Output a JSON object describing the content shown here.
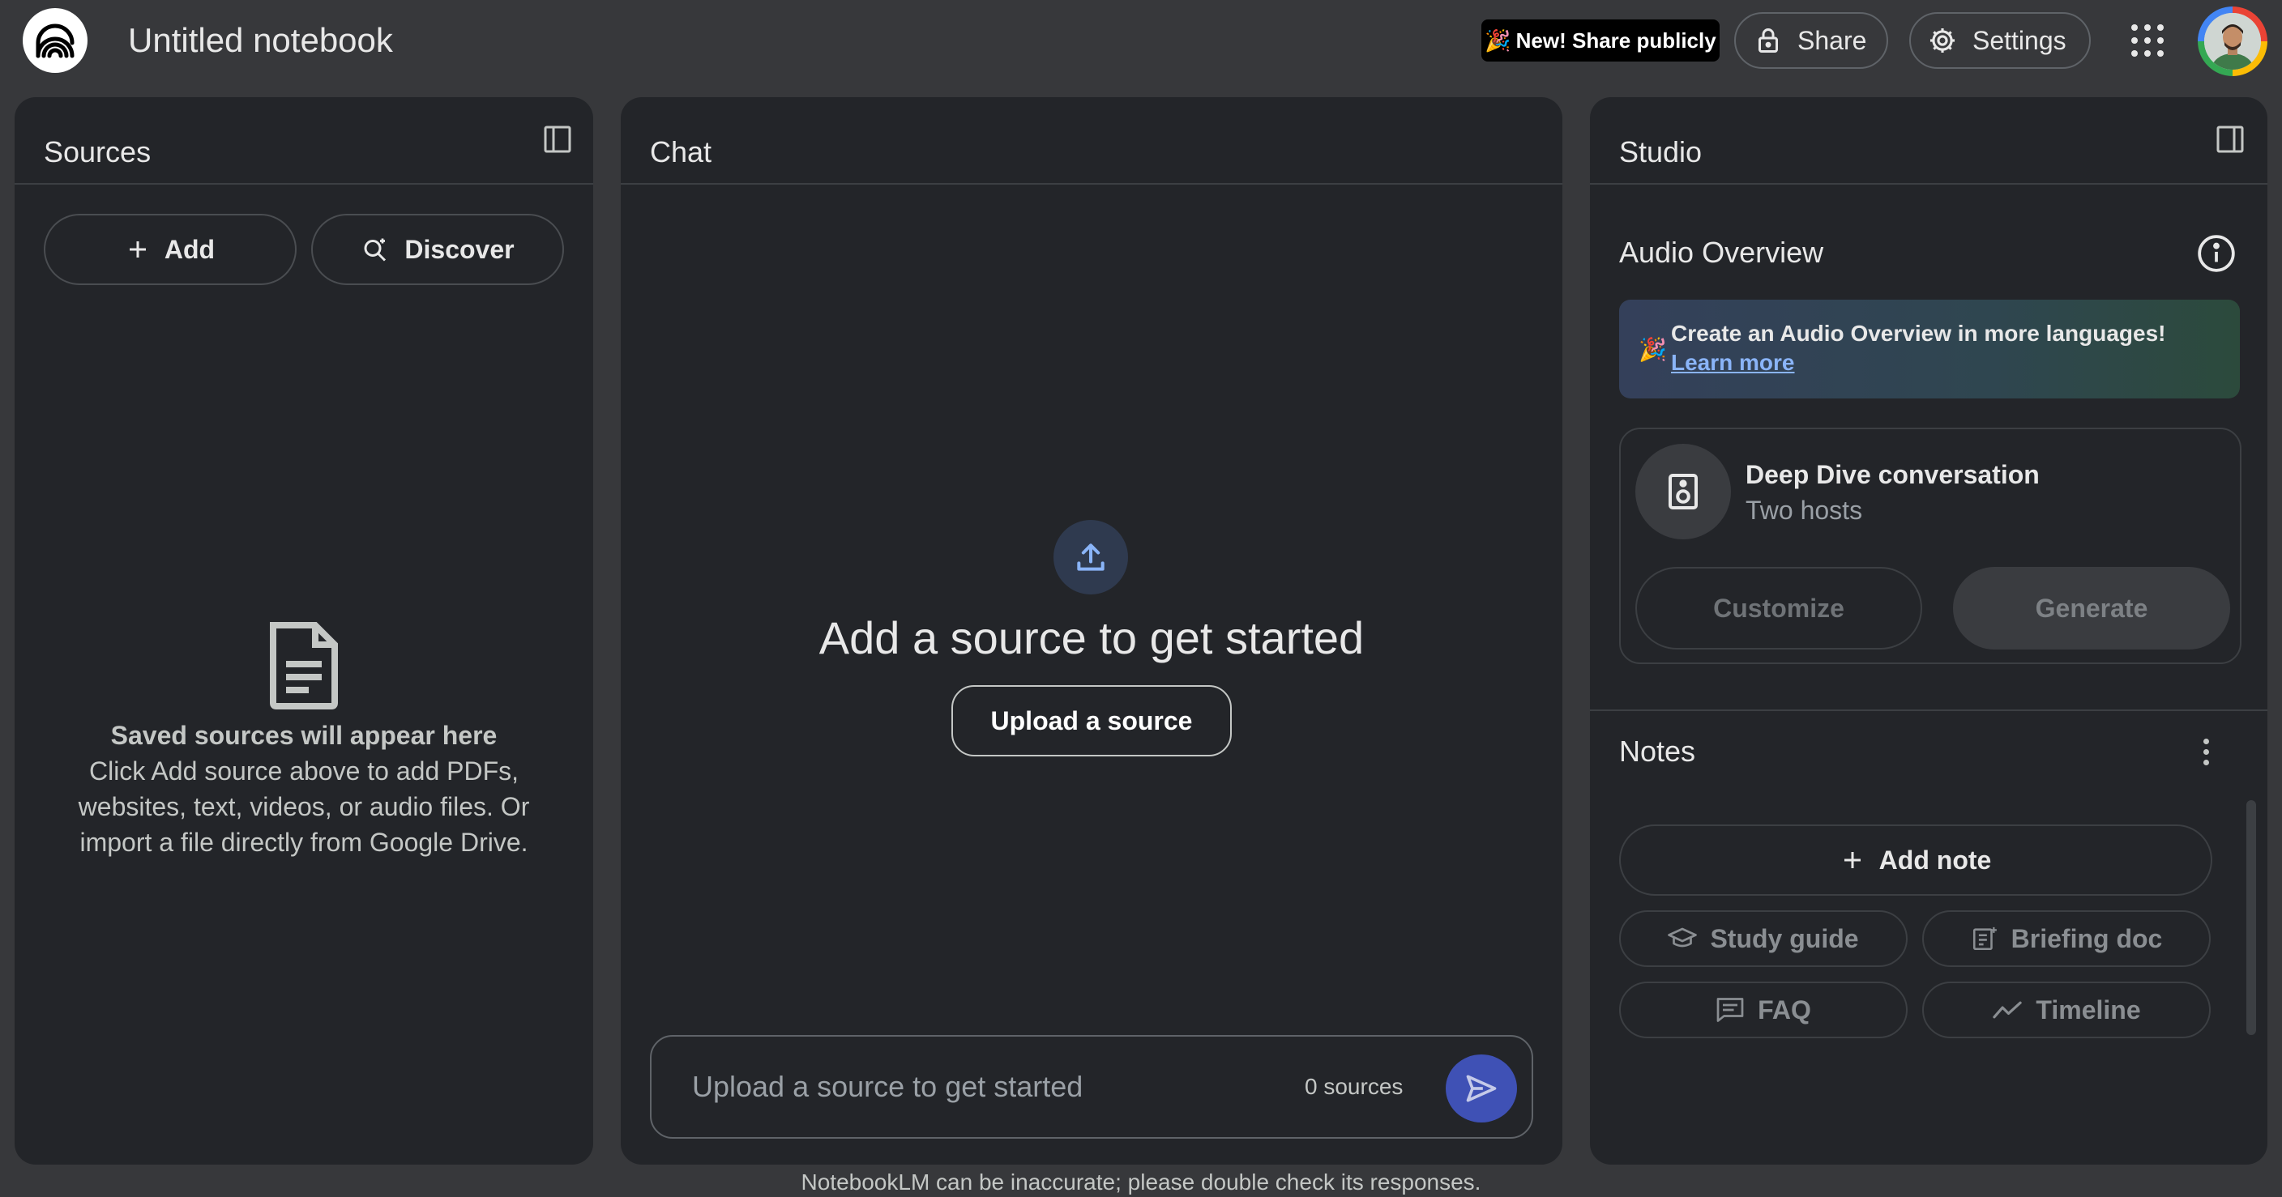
{
  "header": {
    "notebook_title": "Untitled notebook",
    "promo_label": "New! Share publicly",
    "share_label": "Share",
    "settings_label": "Settings"
  },
  "sources": {
    "title": "Sources",
    "add_label": "Add",
    "discover_label": "Discover",
    "empty_heading": "Saved sources will appear here",
    "empty_body": "Click Add source above to add PDFs, websites, text, videos, or audio files. Or import a file directly from Google Drive."
  },
  "chat": {
    "title": "Chat",
    "headline": "Add a source to get started",
    "upload_label": "Upload a source",
    "input_placeholder": "Upload a source to get started",
    "source_count": "0 sources"
  },
  "studio": {
    "title": "Studio",
    "audio_overview": {
      "title": "Audio Overview",
      "banner_text": "Create an Audio Overview in more languages!",
      "banner_link": "Learn more",
      "card_title": "Deep Dive conversation",
      "card_subtitle": "Two hosts",
      "customize_label": "Customize",
      "generate_label": "Generate"
    },
    "notes": {
      "title": "Notes",
      "add_note_label": "Add note",
      "chips": [
        "Study guide",
        "Briefing doc",
        "FAQ",
        "Timeline"
      ]
    }
  },
  "footer": {
    "disclaimer": "NotebookLM can be inaccurate; please double check its responses."
  },
  "icons": {
    "logo": "notebooklm-logo-icon",
    "promo": "party-popper-icon",
    "share": "lock-icon",
    "settings": "gear-icon",
    "apps": "apps-grid-icon",
    "panel_toggle": "side-panel-icon",
    "add": "plus-icon",
    "discover": "search-sparkle-icon",
    "empty_sources": "document-icon",
    "upload": "upload-icon",
    "send": "send-icon",
    "info": "info-icon",
    "speaker": "speaker-icon",
    "study_guide": "graduation-cap-icon",
    "briefing_doc": "briefing-doc-icon",
    "faq": "chat-lines-icon",
    "timeline": "trend-line-icon"
  },
  "colors": {
    "background": "#37383b",
    "panel": "#232529",
    "accent": "#3f51b5",
    "link": "#8ab4f8"
  }
}
